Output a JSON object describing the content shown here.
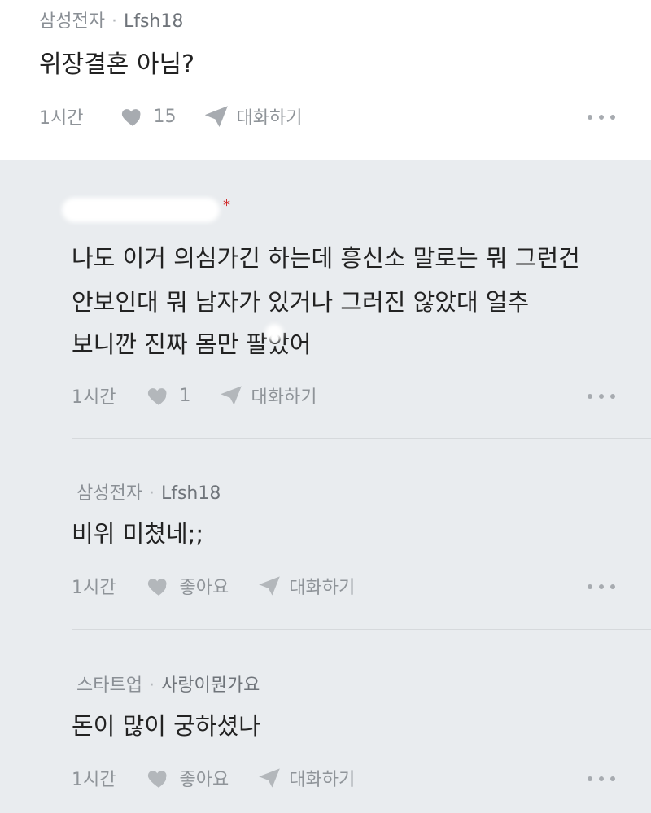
{
  "top_comment": {
    "company": "삼성전자",
    "nickname": "Lfsh18",
    "text": "위장결혼 아님?",
    "time": "1시간",
    "likes": "15",
    "reply_label": "대화하기"
  },
  "reply1": {
    "lines": [
      "나도 이거 의심가긴 하는데 흥신소 말로는 뭐 그런건",
      "안보인대 뭐 남자가 있거나 그러진 않았대 얼추",
      "보니깐 진짜 몸만 팔았어"
    ],
    "time": "1시간",
    "likes": "1",
    "reply_label": "대화하기"
  },
  "reply2": {
    "company": "삼성전자",
    "nickname": "Lfsh18",
    "text": "비위 미쳤네;;",
    "time": "1시간",
    "like_label": "좋아요",
    "reply_label": "대화하기"
  },
  "reply3": {
    "company": "스타트업",
    "nickname": "사랑이뭔가요",
    "text": "돈이 많이 궁하셨나",
    "time": "1시간",
    "like_label": "좋아요",
    "reply_label": "대화하기"
  },
  "colors": {
    "background": "#e9ecef",
    "top_background": "#ffffff",
    "text": "#222222",
    "muted": "#8f9499",
    "accent": "#d02a2a"
  },
  "icons": {
    "like": "heart-icon",
    "reply": "paper-plane-icon",
    "more": "more-dots-icon"
  }
}
